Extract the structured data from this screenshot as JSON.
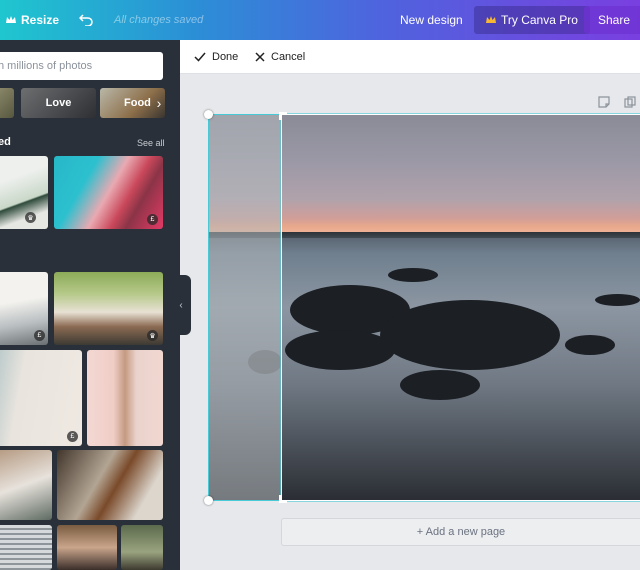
{
  "topbar": {
    "resize_label": "Resize",
    "status": "All changes saved",
    "new_design_label": "New design",
    "try_pro_label": "Try Canva Pro",
    "share_label": "Share",
    "crown_icon": "crown-icon",
    "undo_icon": "undo-icon"
  },
  "sidebar": {
    "search_placeholder": "h millions of photos",
    "chips": [
      "",
      "Love",
      "Food"
    ],
    "section_title": "ed",
    "see_all_label": "See all",
    "badges": {
      "crown": "♛",
      "pro": "£"
    }
  },
  "crop_toolbar": {
    "done_label": "Done",
    "cancel_label": "Cancel"
  },
  "canvas": {
    "add_page_label": "+ Add a new page",
    "accent_color": "#48c9d6"
  }
}
